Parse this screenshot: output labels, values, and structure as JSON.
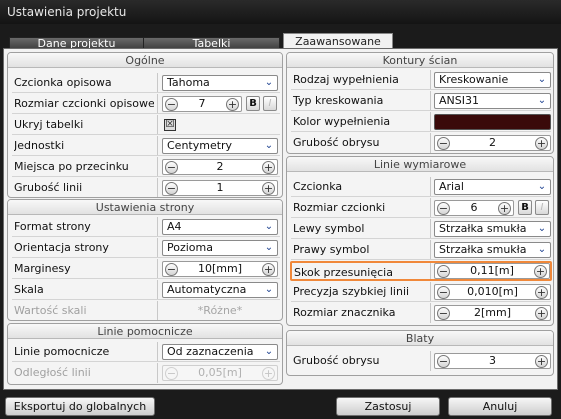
{
  "window": {
    "title": "Ustawienia projektu"
  },
  "tabs": [
    {
      "label": "Dane projektu"
    },
    {
      "label": "Tabelki"
    },
    {
      "label": "Zaawansowane"
    }
  ],
  "ogolne": {
    "title": "Ogólne",
    "rows": [
      {
        "label": "Czcionka opisowa",
        "value": "Tahoma"
      },
      {
        "label": "Rozmiar czcionki opisowej",
        "value": "7",
        "bold": "B",
        "italic": "I"
      },
      {
        "label": "Ukryj tabelki",
        "checked": "☒"
      },
      {
        "label": "Jednostki",
        "value": "Centymetry"
      },
      {
        "label": "Miejsca po przecinku",
        "value": "2"
      },
      {
        "label": "Grubość linii",
        "value": "1"
      }
    ]
  },
  "ustawienia_strony": {
    "title": "Ustawienia strony",
    "rows": [
      {
        "label": "Format strony",
        "value": "A4"
      },
      {
        "label": "Orientacja strony",
        "value": "Pozioma"
      },
      {
        "label": "Marginesy",
        "value": "10[mm]"
      },
      {
        "label": "Skala",
        "value": "Automatyczna"
      },
      {
        "label": "Wartość skali",
        "value": "*Różne*"
      }
    ]
  },
  "linie_pomocnicze": {
    "title": "Linie pomocnicze",
    "rows": [
      {
        "label": "Linie pomocnicze",
        "value": "Od zaznaczenia"
      },
      {
        "label": "Odległość linii",
        "value": "0,05[m]"
      }
    ]
  },
  "kontury_scian": {
    "title": "Kontury ścian",
    "rows": [
      {
        "label": "Rodzaj wypełnienia",
        "value": "Kreskowanie"
      },
      {
        "label": "Typ kreskowania",
        "value": "ANSI31"
      },
      {
        "label": "Kolor wypełnienia",
        "color": "#3a0a0a"
      },
      {
        "label": "Grubość obrysu",
        "value": "2"
      }
    ]
  },
  "linie_wymiarowe": {
    "title": "Linie wymiarowe",
    "rows": [
      {
        "label": "Czcionka",
        "value": "Arial"
      },
      {
        "label": "Rozmiar czcionki",
        "value": "6",
        "bold": "B",
        "italic": "I"
      },
      {
        "label": "Lewy symbol",
        "value": "Strzałka smukła"
      },
      {
        "label": "Prawy symbol",
        "value": "Strzałka smukła"
      },
      {
        "label": "Skok przesunięcia",
        "value": "0,11[m]"
      },
      {
        "label": "Precyzja szybkiej linii",
        "value": "0,010[m]"
      },
      {
        "label": "Rozmiar znacznika",
        "value": "2[mm]"
      }
    ]
  },
  "blaty": {
    "title": "Blaty",
    "rows": [
      {
        "label": "Grubość obrysu",
        "value": "3"
      }
    ]
  },
  "stepper_glyphs": {
    "minus": "−",
    "plus": "+"
  },
  "dropdown_arrow": "❯",
  "footer": {
    "export_label": "Eksportuj do globalnych",
    "apply_label": "Zastosuj",
    "cancel_label": "Anuluj"
  },
  "colors": {
    "highlight": "#f0883a",
    "dropdown_arrow": "#1a3f8f",
    "title_bar": "#1b1b1b"
  },
  "icons": [
    "chevron-down-icon",
    "minus-icon",
    "plus-icon",
    "checkbox-checked-icon"
  ]
}
